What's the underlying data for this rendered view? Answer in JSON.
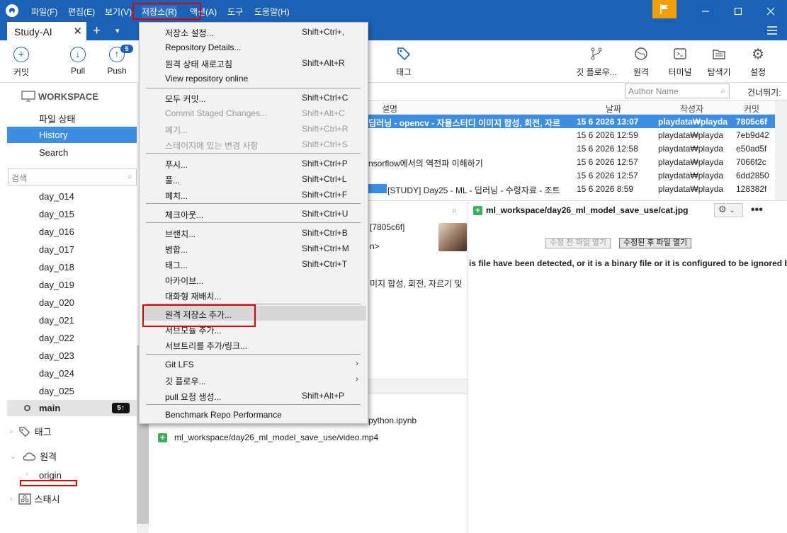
{
  "menubar": {
    "items": [
      "파일(F)",
      "편집(E)",
      "보기(V)",
      "저장소(R)",
      "액션(A)",
      "도구",
      "도움말(H)"
    ]
  },
  "tab": {
    "title": "Study-AI",
    "close": "✕",
    "add": "+",
    "more": "▾"
  },
  "toolbar": {
    "commit": "커밋",
    "pull": "Pull",
    "push": "Push",
    "push_count": "5",
    "tag": "태그",
    "gitflow": "깃 플로우...",
    "remote": "원격",
    "terminal": "터미널",
    "explorer": "탐색기",
    "settings": "설정"
  },
  "sidebar": {
    "workspace": "WORKSPACE",
    "links": [
      "파일 상태",
      "History",
      "Search"
    ],
    "search_placeholder": "검색",
    "branches": [
      "day_014",
      "day_015",
      "day_016",
      "day_017",
      "day_018",
      "day_019",
      "day_020",
      "day_021",
      "day_022",
      "day_023",
      "day_024",
      "day_025"
    ],
    "main": {
      "name": "main",
      "badge": "5↑"
    },
    "tags": "태그",
    "remotes": "원격",
    "remote_item": "origin",
    "stash": "스태시"
  },
  "log": {
    "author_placeholder": "Author Name",
    "skip": "건너뛰기:",
    "columns": {
      "desc": "설명",
      "date": "날짜",
      "author": "작성자",
      "commit": "커밋"
    },
    "rows": [
      {
        "desc": "딥러닝 - opencv - 자율스터디 이미지 합성, 회전, 자르",
        "date": "15 6 2026 13:07",
        "author": "playdata₩playda",
        "commit": "7805c6f"
      },
      {
        "desc": "",
        "date": "15 6 2026 12:59",
        "author": "playdata₩playda",
        "commit": "7eb9d42"
      },
      {
        "desc": "",
        "date": "15 6 2026 12:58",
        "author": "playdata₩playda",
        "commit": "e50ad5f"
      },
      {
        "desc": "nsorflow에서의 역전파 이해하기",
        "date": "15 6 2026 12:57",
        "author": "playdata₩playda",
        "commit": "7066f2c"
      },
      {
        "desc": "",
        "date": "15 6 2026 12:57",
        "author": "playdata₩playda",
        "commit": "6dd2850"
      },
      {
        "desc": "[STUDY] Day25 - ML - 딥러닝 - 수령자료 - 조트",
        "date": "15 6 2026 8:59",
        "author": "playdata₩playda",
        "commit": "128382f"
      }
    ]
  },
  "details": {
    "commit_ref": "[7805c6f]",
    "line2": "n>",
    "line3": "미지 합성, 회전, 자르기 및"
  },
  "files": [
    "python.ipynb",
    "ml_workspace/day26_ml_model_save_use/video.mp4"
  ],
  "diff": {
    "file": "ml_workspace/day26_ml_model_save_use/cat.jpg",
    "btn_before": "수정 전 파일 열기",
    "btn_after": "수정된 후 파일 열기",
    "message": "is file have been detected, or it is a binary file or it is configured to be ignored by"
  },
  "repo_menu": {
    "items": [
      {
        "label": "저장소 설정...",
        "shortcut": "Shift+Ctrl+,"
      },
      {
        "label": "Repository Details...",
        "shortcut": ""
      },
      {
        "label": "원격 상태 새로고침",
        "shortcut": "Shift+Alt+R"
      },
      {
        "label": "View repository online",
        "shortcut": ""
      },
      {
        "label": "모두 커밋...",
        "shortcut": "Shift+Ctrl+C"
      },
      {
        "label": "Commit Staged Changes...",
        "shortcut": "Shift+Alt+C"
      },
      {
        "label": "폐기...",
        "shortcut": "Shift+Ctrl+R"
      },
      {
        "label": "스테이지에 있는 변경 사항",
        "shortcut": "Shift+Ctrl+S"
      },
      {
        "label": "푸시...",
        "shortcut": "Shift+Ctrl+P"
      },
      {
        "label": "풀...",
        "shortcut": "Shift+Ctrl+L"
      },
      {
        "label": "페치...",
        "shortcut": "Shift+Ctrl+F"
      },
      {
        "label": "체크아웃...",
        "shortcut": "Shift+Ctrl+U"
      },
      {
        "label": "브랜치...",
        "shortcut": "Shift+Ctrl+B"
      },
      {
        "label": "병합...",
        "shortcut": "Shift+Ctrl+M"
      },
      {
        "label": "태그...",
        "shortcut": "Shift+Ctrl+T"
      },
      {
        "label": "아카이브...",
        "shortcut": ""
      },
      {
        "label": "대화형 재배치...",
        "shortcut": ""
      },
      {
        "label": "원격 저장소 추가...",
        "shortcut": ""
      },
      {
        "label": "서브모듈 추가...",
        "shortcut": ""
      },
      {
        "label": "서브트리를 추가/링크...",
        "shortcut": ""
      },
      {
        "label": "Git LFS",
        "shortcut": ""
      },
      {
        "label": "깃 플로우...",
        "shortcut": ""
      },
      {
        "label": "pull 요청 생성...",
        "shortcut": "Shift+Alt+P"
      },
      {
        "label": "Benchmark Repo Performance",
        "shortcut": ""
      }
    ]
  },
  "colors": {
    "accent": "#1b62b7",
    "selection": "#3d8de0",
    "annotation": "#e00000",
    "flag": "#f2a000"
  }
}
